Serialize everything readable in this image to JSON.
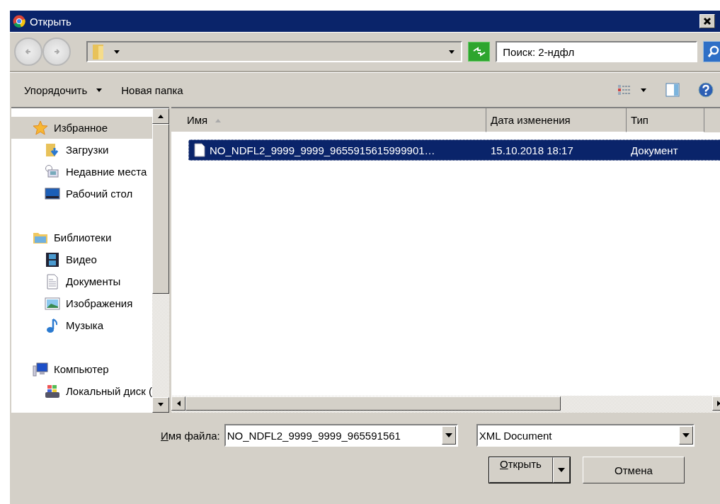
{
  "window": {
    "title": "Открыть"
  },
  "search": {
    "placeholder": "Поиск: 2-ндфл"
  },
  "toolbar": {
    "organize": "Упорядочить",
    "new_folder": "Новая папка"
  },
  "sidebar": {
    "groups": [
      {
        "label": "Избранное",
        "kind": "favorites",
        "selected": true,
        "children": [
          {
            "label": "Загрузки",
            "kind": "downloads",
            "selected": false
          },
          {
            "label": "Недавние места",
            "kind": "recent",
            "selected": false
          },
          {
            "label": "Рабочий стол",
            "kind": "desktop",
            "selected": false
          }
        ]
      },
      {
        "label": "Библиотеки",
        "kind": "libraries",
        "selected": false,
        "children": [
          {
            "label": "Видео",
            "kind": "video",
            "selected": false
          },
          {
            "label": "Документы",
            "kind": "documents",
            "selected": false
          },
          {
            "label": "Изображения",
            "kind": "images",
            "selected": false
          },
          {
            "label": "Музыка",
            "kind": "music",
            "selected": false
          }
        ]
      },
      {
        "label": "Компьютер",
        "kind": "computer",
        "selected": false,
        "children": [
          {
            "label": "Локальный диск (",
            "kind": "disk",
            "selected": false
          }
        ]
      }
    ]
  },
  "table": {
    "columns": [
      {
        "label": "Имя",
        "sorted": true
      },
      {
        "label": "Дата изменения",
        "sorted": false
      },
      {
        "label": "Тип",
        "sorted": false
      }
    ],
    "rows": [
      {
        "cells": [
          "NO_NDFL2_9999_9999_9655915615999901…",
          "15.10.2018 18:17",
          "Документ"
        ],
        "selected": true
      }
    ]
  },
  "footer": {
    "filename_label": "Имя файла:",
    "filename": "NO_NDFL2_9999_9999_965591561",
    "filter": "XML Document",
    "open_button": "Открыть",
    "cancel_button": "Отмена"
  }
}
